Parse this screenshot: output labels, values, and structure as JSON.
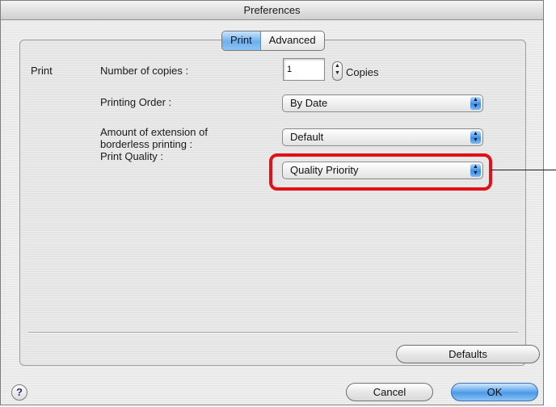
{
  "window": {
    "title": "Preferences"
  },
  "tabs": [
    {
      "label": "Print",
      "active": true
    },
    {
      "label": "Advanced",
      "active": false
    }
  ],
  "section_label": "Print",
  "fields": {
    "copies_label": "Number of copies :",
    "copies_value": "1",
    "copies_unit": "Copies",
    "order_label": "Printing Order :",
    "order_value": "By Date",
    "extension_label_line1": "Amount of extension of",
    "extension_label_line2": "borderless printing :",
    "extension_value": "Default",
    "quality_label": "Print Quality :",
    "quality_value": "Quality Priority"
  },
  "buttons": {
    "defaults": "Defaults",
    "cancel": "Cancel",
    "ok": "OK",
    "help": "?"
  },
  "colors": {
    "highlight": "#e01217",
    "accent_blue": "#4b9ae8"
  }
}
